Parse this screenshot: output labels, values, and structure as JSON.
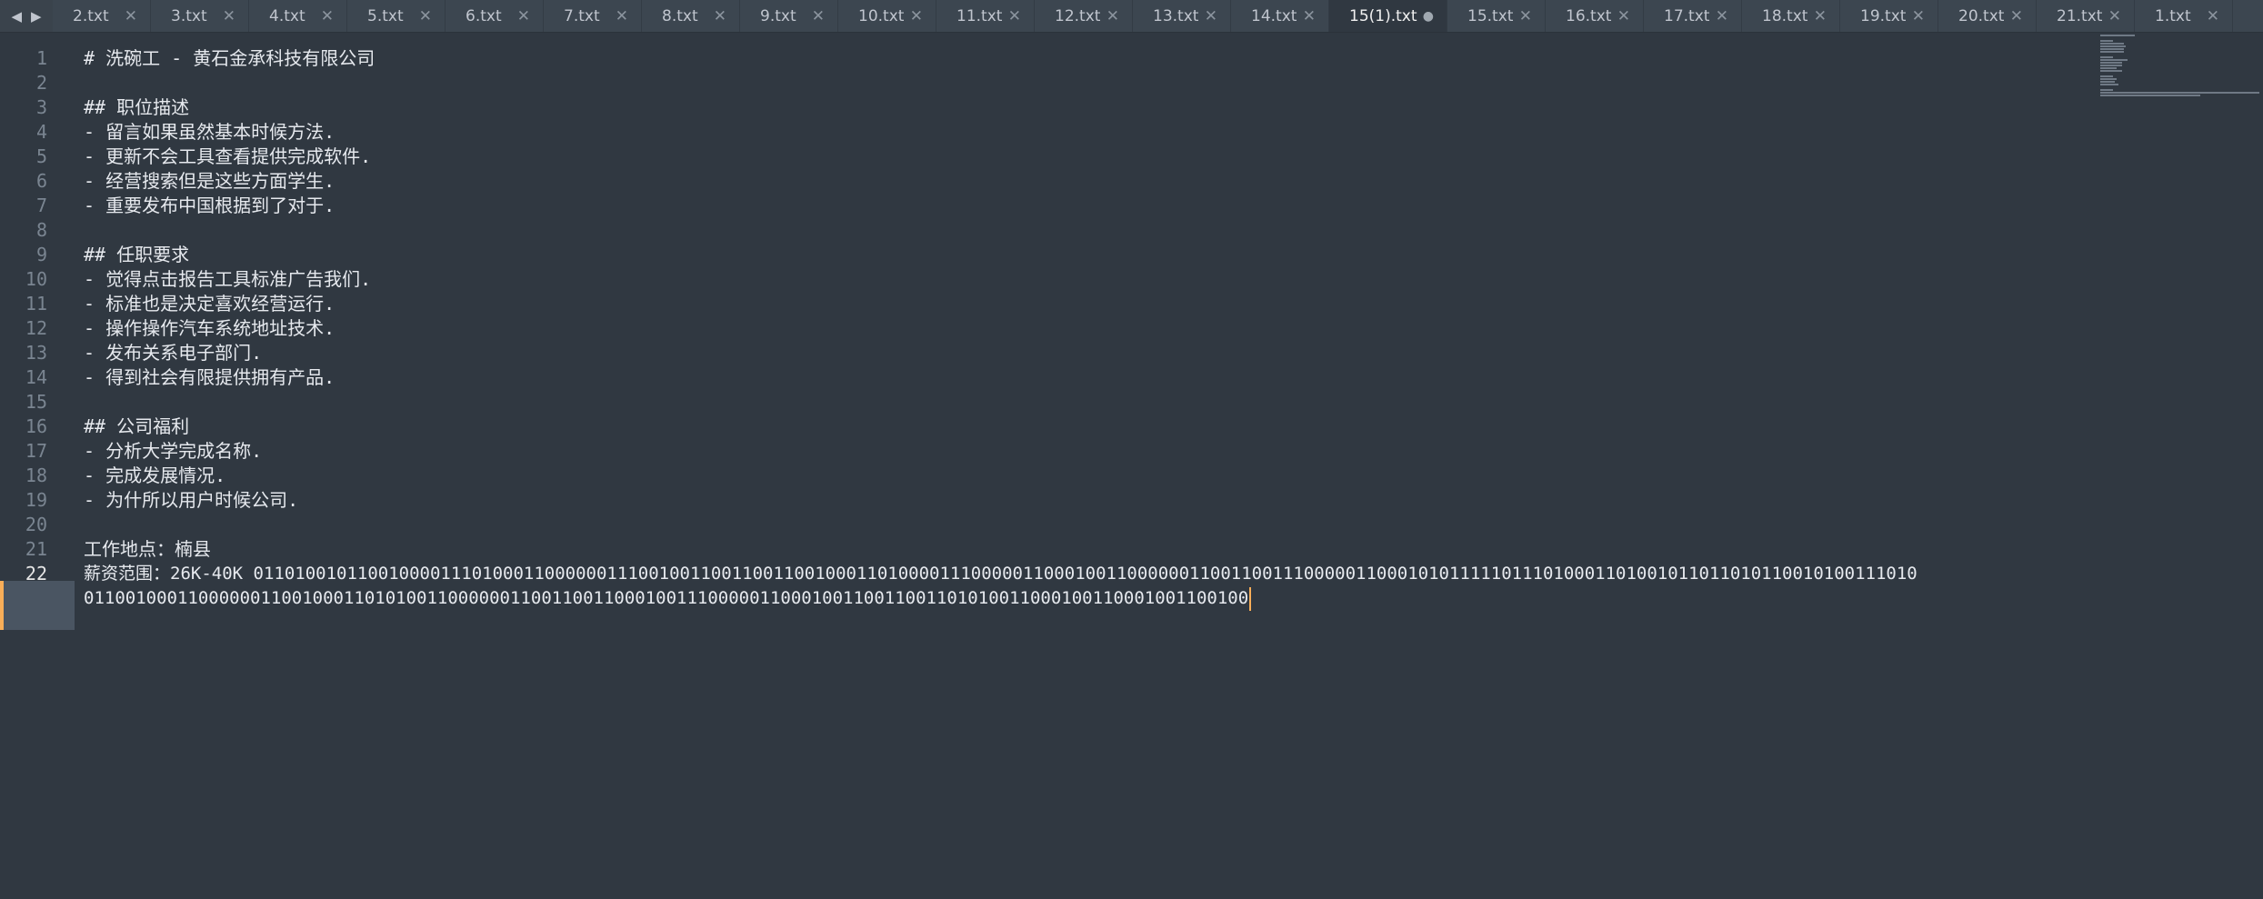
{
  "tabs": {
    "nav_left": "◀",
    "nav_right": "▶",
    "items": [
      {
        "label": "2.txt",
        "close": "✕"
      },
      {
        "label": "3.txt",
        "close": "✕"
      },
      {
        "label": "4.txt",
        "close": "✕"
      },
      {
        "label": "5.txt",
        "close": "✕"
      },
      {
        "label": "6.txt",
        "close": "✕"
      },
      {
        "label": "7.txt",
        "close": "✕"
      },
      {
        "label": "8.txt",
        "close": "✕"
      },
      {
        "label": "9.txt",
        "close": "✕"
      },
      {
        "label": "10.txt",
        "close": "✕"
      },
      {
        "label": "11.txt",
        "close": "✕"
      },
      {
        "label": "12.txt",
        "close": "✕"
      },
      {
        "label": "13.txt",
        "close": "✕"
      },
      {
        "label": "14.txt",
        "close": "✕"
      },
      {
        "label": "15(1).txt",
        "close": "●"
      },
      {
        "label": "15.txt",
        "close": "✕"
      },
      {
        "label": "16.txt",
        "close": "✕"
      },
      {
        "label": "17.txt",
        "close": "✕"
      },
      {
        "label": "18.txt",
        "close": "✕"
      },
      {
        "label": "19.txt",
        "close": "✕"
      },
      {
        "label": "20.txt",
        "close": "✕"
      },
      {
        "label": "21.txt",
        "close": "✕"
      },
      {
        "label": "1.txt",
        "close": "✕"
      }
    ]
  },
  "editor": {
    "line_numbers": [
      "1",
      "2",
      "3",
      "4",
      "5",
      "6",
      "7",
      "8",
      "9",
      "10",
      "11",
      "12",
      "13",
      "14",
      "15",
      "16",
      "17",
      "18",
      "19",
      "20",
      "21",
      "22"
    ],
    "lines": [
      "# 洗碗工 - 黄石金承科技有限公司",
      "",
      "## 职位描述",
      "- 留言如果虽然基本时候方法.",
      "- 更新不会工具查看提供完成软件.",
      "- 经营搜索但是这些方面学生.",
      "- 重要发布中国根据到了对于.",
      "",
      "## 任职要求",
      "- 觉得点击报告工具标准广告我们.",
      "- 标准也是决定喜欢经营运行.",
      "- 操作操作汽车系统地址技术.",
      "- 发布关系电子部门.",
      "- 得到社会有限提供拥有产品.",
      "",
      "## 公司福利",
      "- 分析大学完成名称.",
      "- 完成发展情况.",
      "- 为什所以用户时候公司.",
      "",
      "工作地点：楠县",
      "薪资范围：26K-40K 0110100101100100001110100011000000111001001100110011001000110100001110000011000100110000001100110011100000110001010111110111010001101001011011010110010100111010",
      "0110010001100000011001000110101001100000011001100110001001110000011000100110011001101010011000100110001001100100"
    ]
  },
  "colors": {
    "background": "#303841",
    "tabbar": "#3c4650",
    "caret": "#f9ae58",
    "current_line_marker": "#f9ae58"
  }
}
